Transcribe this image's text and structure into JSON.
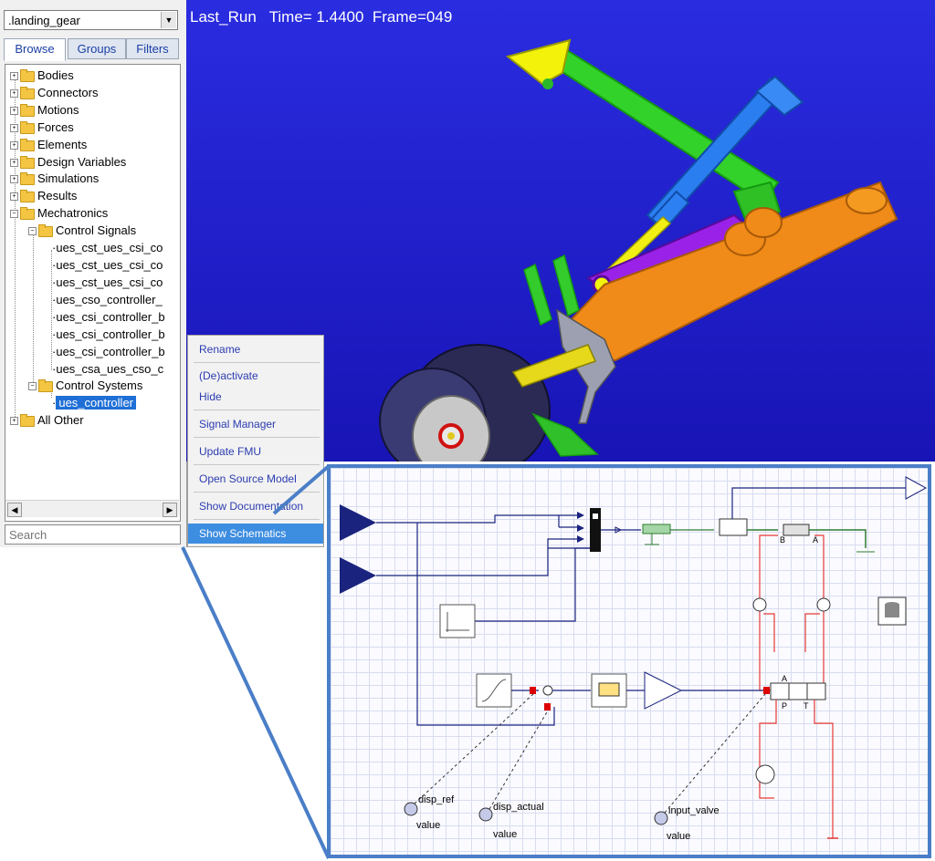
{
  "browser": {
    "model": ".landing_gear",
    "tabs": [
      "Browse",
      "Groups",
      "Filters"
    ],
    "tree": [
      {
        "label": "Bodies"
      },
      {
        "label": "Connectors"
      },
      {
        "label": "Motions"
      },
      {
        "label": "Forces"
      },
      {
        "label": "Elements"
      },
      {
        "label": "Design Variables"
      },
      {
        "label": "Simulations"
      },
      {
        "label": "Results"
      },
      {
        "label": "Mechatronics"
      },
      {
        "label": "Control Signals"
      },
      {
        "label": "ues_cst_ues_csi_co"
      },
      {
        "label": "ues_cst_ues_csi_co"
      },
      {
        "label": "ues_cst_ues_csi_co"
      },
      {
        "label": "ues_cso_controller_"
      },
      {
        "label": "ues_csi_controller_b"
      },
      {
        "label": "ues_csi_controller_b"
      },
      {
        "label": "ues_csi_controller_b"
      },
      {
        "label": "ues_csa_ues_cso_c"
      },
      {
        "label": "Control Systems"
      },
      {
        "label": "ues_controller"
      },
      {
        "label": "All Other"
      }
    ],
    "search_placeholder": "Search"
  },
  "viewport": {
    "title": "Last_Run   Time= 1.4400  Frame=049"
  },
  "context_menu": {
    "items": [
      "Rename",
      "(De)activate",
      "Hide",
      "Signal Manager",
      "Update FMU",
      "Open Source Model",
      "Show Documentation",
      "Show Schematics"
    ],
    "highlighted": "Show Schematics"
  },
  "schematic": {
    "labels": {
      "disp_ref": "disp_ref",
      "disp_actual": "disp_actual",
      "input_valve": "input_valve",
      "value": "value",
      "port_a": "A",
      "port_b": "B",
      "port_p": "P",
      "port_t": "T"
    }
  }
}
